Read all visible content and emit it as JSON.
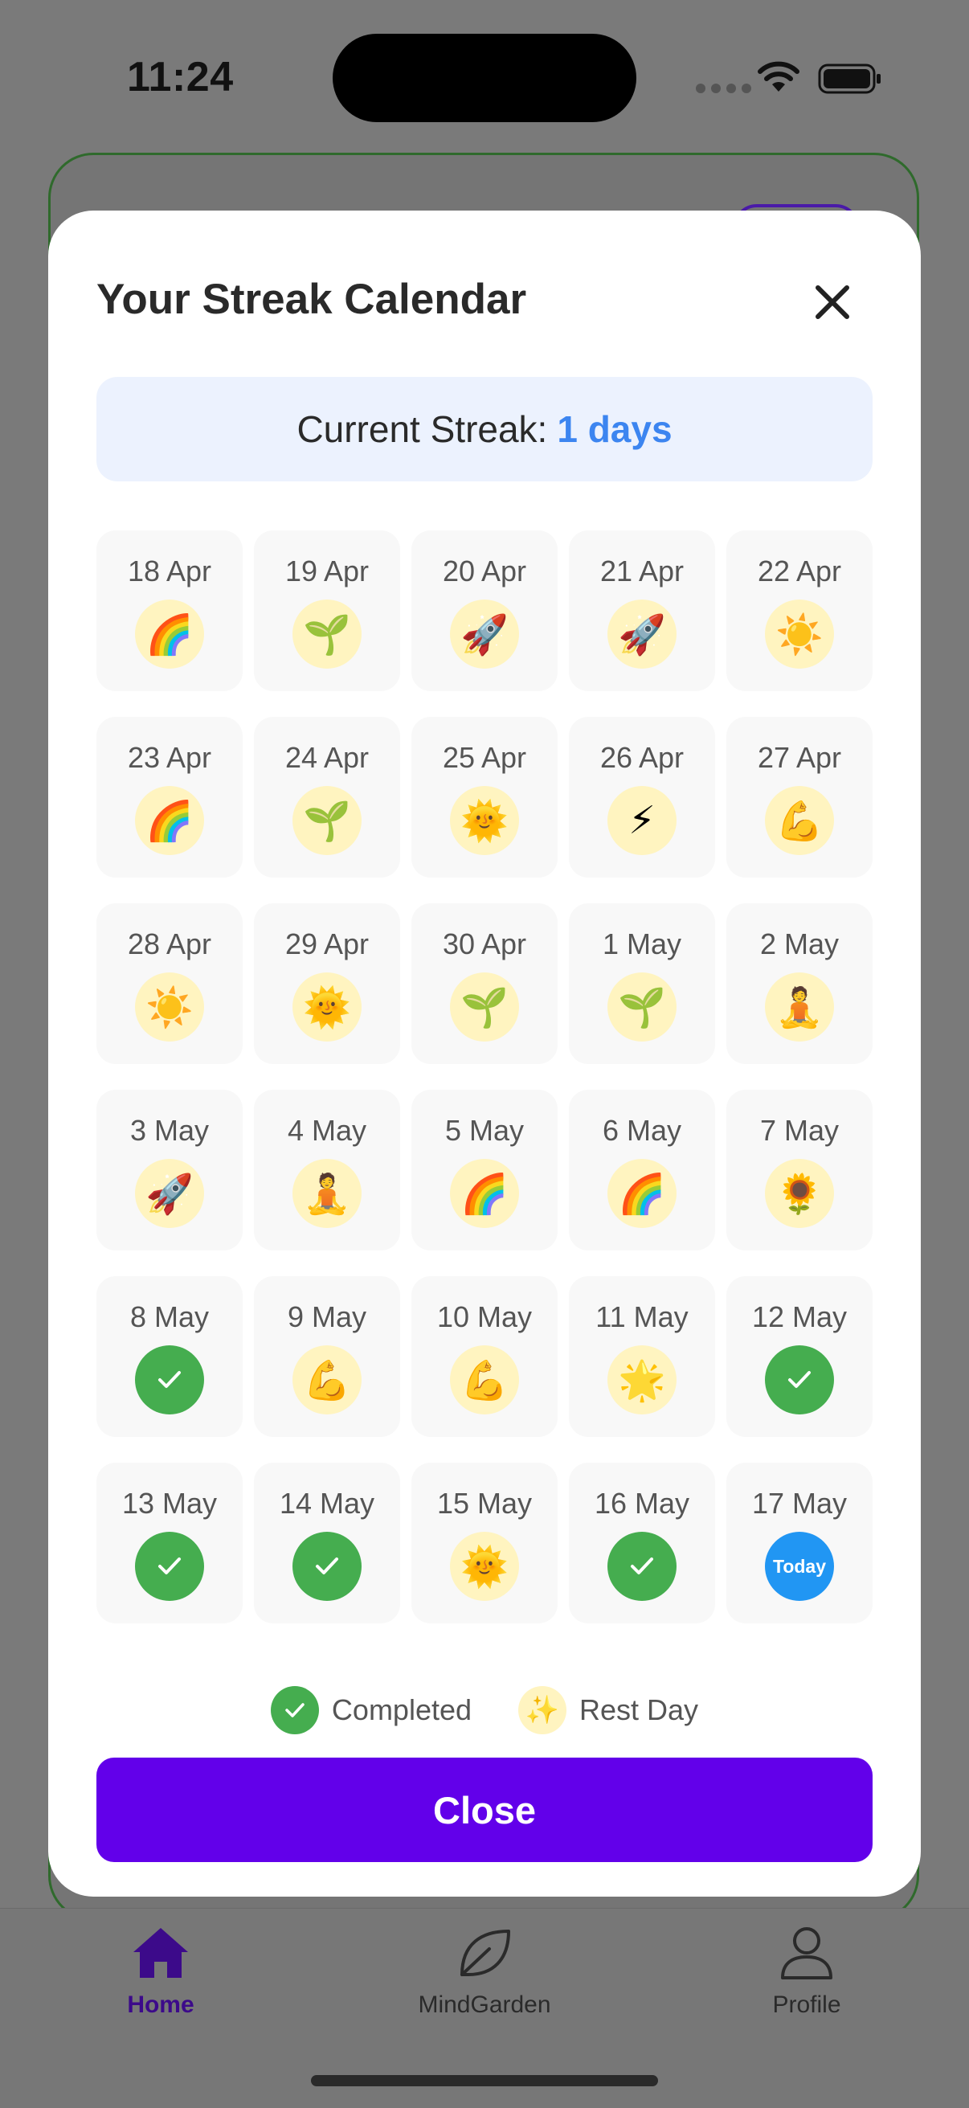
{
  "status_bar": {
    "time": "11:24"
  },
  "modal": {
    "title": "Your Streak Calendar",
    "streak_label": "Current Streak:",
    "streak_value": "1 days",
    "close_button": "Close"
  },
  "days": [
    {
      "date": "18 Apr",
      "type": "emoji",
      "emoji": "🌈"
    },
    {
      "date": "19 Apr",
      "type": "emoji",
      "emoji": "🌱"
    },
    {
      "date": "20 Apr",
      "type": "emoji",
      "emoji": "🚀"
    },
    {
      "date": "21 Apr",
      "type": "emoji",
      "emoji": "🚀"
    },
    {
      "date": "22 Apr",
      "type": "emoji",
      "emoji": "☀️"
    },
    {
      "date": "23 Apr",
      "type": "emoji",
      "emoji": "🌈"
    },
    {
      "date": "24 Apr",
      "type": "emoji",
      "emoji": "🌱"
    },
    {
      "date": "25 Apr",
      "type": "emoji",
      "emoji": "🌞"
    },
    {
      "date": "26 Apr",
      "type": "emoji",
      "emoji": "⚡"
    },
    {
      "date": "27 Apr",
      "type": "emoji",
      "emoji": "💪"
    },
    {
      "date": "28 Apr",
      "type": "emoji",
      "emoji": "☀️"
    },
    {
      "date": "29 Apr",
      "type": "emoji",
      "emoji": "🌞"
    },
    {
      "date": "30 Apr",
      "type": "emoji",
      "emoji": "🌱"
    },
    {
      "date": "1 May",
      "type": "emoji",
      "emoji": "🌱"
    },
    {
      "date": "2 May",
      "type": "emoji",
      "emoji": "🧘"
    },
    {
      "date": "3 May",
      "type": "emoji",
      "emoji": "🚀"
    },
    {
      "date": "4 May",
      "type": "emoji",
      "emoji": "🧘"
    },
    {
      "date": "5 May",
      "type": "emoji",
      "emoji": "🌈"
    },
    {
      "date": "6 May",
      "type": "emoji",
      "emoji": "🌈"
    },
    {
      "date": "7 May",
      "type": "emoji",
      "emoji": "🌻"
    },
    {
      "date": "8 May",
      "type": "done"
    },
    {
      "date": "9 May",
      "type": "emoji",
      "emoji": "💪"
    },
    {
      "date": "10 May",
      "type": "emoji",
      "emoji": "💪"
    },
    {
      "date": "11 May",
      "type": "emoji",
      "emoji": "🌟"
    },
    {
      "date": "12 May",
      "type": "done"
    },
    {
      "date": "13 May",
      "type": "done"
    },
    {
      "date": "14 May",
      "type": "done"
    },
    {
      "date": "15 May",
      "type": "emoji",
      "emoji": "🌞"
    },
    {
      "date": "16 May",
      "type": "done"
    },
    {
      "date": "17 May",
      "type": "today",
      "badge_text": "Today"
    }
  ],
  "legend": {
    "completed_label": "Completed",
    "rest_label": "Rest Day",
    "rest_emoji": "✨"
  },
  "tabs": [
    {
      "label": "Home",
      "icon": "home-icon",
      "active": true
    },
    {
      "label": "MindGarden",
      "icon": "leaf-icon",
      "active": false
    },
    {
      "label": "Profile",
      "icon": "person-icon",
      "active": false
    }
  ],
  "colors": {
    "accent": "#6200ea",
    "streak_value": "#3c85f0",
    "completed": "#45ad4f",
    "today": "#2196f3",
    "rest_badge": "#fff4c0",
    "active_tab": "#3c0a8a"
  }
}
